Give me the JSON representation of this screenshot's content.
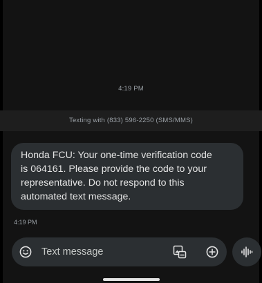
{
  "conversation": {
    "header_time": "4:19 PM",
    "texting_banner": "Texting with (833) 596-2250 (SMS/MMS)"
  },
  "message": {
    "lines": [
      "Honda FCU: Your one-time verification code",
      "is 064161.  Please provide the code to your",
      "representative. Do not respond to this",
      "automated text message."
    ],
    "time": "4:19 PM"
  },
  "compose": {
    "placeholder": "Text message"
  },
  "icons": {
    "emoji": "smiley-face-icon",
    "gallery": "image-gallery-icon",
    "add": "add-circle-icon",
    "voice": "voice-waveform-icon"
  },
  "colors": {
    "background": "#131313",
    "banner": "#1e1e1e",
    "bubble": "#2b2f32",
    "text": "#e3e3e3",
    "secondary_text": "#9aa0a6"
  }
}
